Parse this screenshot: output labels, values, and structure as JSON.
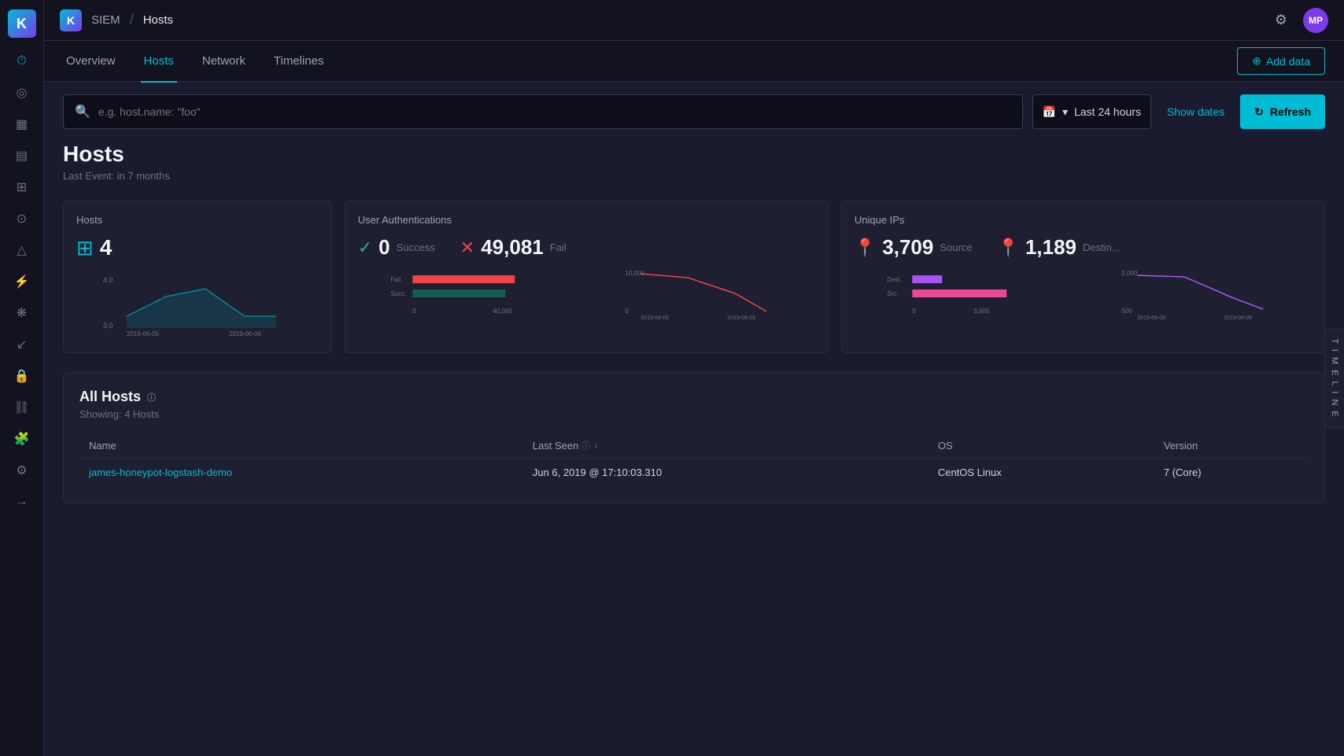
{
  "app": {
    "brand": "SIEM",
    "page": "Hosts",
    "logo_text": "K",
    "avatar_text": "MP"
  },
  "tabs": [
    {
      "label": "Overview",
      "active": false
    },
    {
      "label": "Hosts",
      "active": true
    },
    {
      "label": "Network",
      "active": false
    },
    {
      "label": "Timelines",
      "active": false
    }
  ],
  "add_data_label": "Add data",
  "search": {
    "placeholder": "e.g. host.name: \"foo\""
  },
  "time": {
    "label": "Last 24 hours"
  },
  "show_dates_label": "Show dates",
  "refresh_label": "Refresh",
  "page_title": "Hosts",
  "page_subtitle": "Last Event: in 7 months",
  "cards": {
    "hosts": {
      "title": "Hosts",
      "count": "4"
    },
    "user_auth": {
      "title": "User Authentications",
      "success_count": "0",
      "success_label": "Success",
      "fail_count": "49,081",
      "fail_label": "Fail"
    },
    "unique_ips": {
      "title": "Unique IPs",
      "source_count": "3,709",
      "source_label": "Source",
      "dest_count": "1,189",
      "dest_label": "Destin..."
    }
  },
  "chart_dates": {
    "start": "2019-06-05",
    "end": "2019-06-06"
  },
  "all_hosts": {
    "title": "All Hosts",
    "subtitle": "Showing: 4 Hosts",
    "columns": [
      "Name",
      "Last Seen",
      "OS",
      "Version"
    ],
    "rows": [
      {
        "name": "james-honeypot-logstash-demo",
        "last_seen": "Jun 6, 2019 @ 17:10:03.310",
        "os": "CentOS Linux",
        "version": "7 (Core)"
      }
    ]
  },
  "timeline_label": "T I M E L I N E",
  "sidebar_icons": [
    "☰",
    "⏰",
    "📊",
    "📋",
    "📅",
    "👤",
    "🔔",
    "⚡",
    "🔧",
    "📌",
    "↩",
    "🔒",
    "🔗",
    "🧠",
    "⚙",
    "→"
  ]
}
